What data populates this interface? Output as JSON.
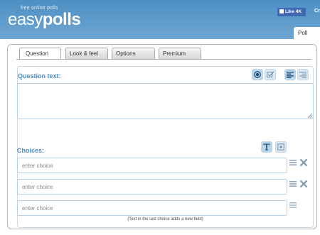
{
  "header": {
    "logo_tagline": "free online polls",
    "logo_light": "easy",
    "logo_bold": "polls",
    "like_label": "Like 4K",
    "cut_label": "Cr"
  },
  "poll_tab": "Poll",
  "tabs": [
    {
      "label": "Question",
      "active": true
    },
    {
      "label": "Look & feel",
      "active": false
    },
    {
      "label": "Options",
      "active": false
    },
    {
      "label": "Premium",
      "active": false
    }
  ],
  "question": {
    "label": "Question text:",
    "value": ""
  },
  "choices": {
    "label": "Choices:",
    "items": [
      {
        "placeholder": "enter choice",
        "value": ""
      },
      {
        "placeholder": "enter choice",
        "value": ""
      },
      {
        "placeholder": "enter choice",
        "value": ""
      }
    ],
    "hint": "(Text in the last choice adds a new field)"
  },
  "colors": {
    "accent": "#4d8cc3",
    "brand_bg": "#6ea6d2",
    "fb": "#4267b2"
  }
}
